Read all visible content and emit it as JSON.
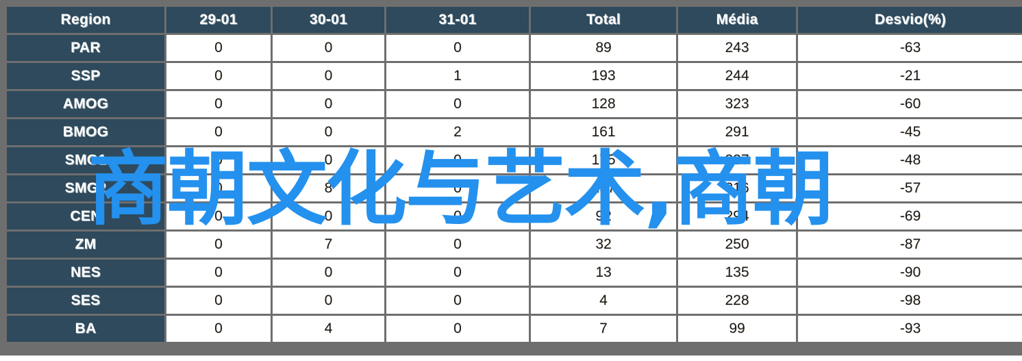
{
  "colors": {
    "header_bg": "#2e4a5c",
    "header_text": "#ffffff",
    "grid_border": "#6e6e6e",
    "cell_bg": "#ffffff",
    "cell_text": "#1a1a1a",
    "overlay_blue": "#2491ee"
  },
  "overlay": {
    "text": "商朝文化与艺术,商朝"
  },
  "table": {
    "columns": [
      "Region",
      "29-01",
      "30-01",
      "31-01",
      "Total",
      "Média",
      "Desvio(%)"
    ],
    "rows": [
      {
        "region": "PAR",
        "d29": "0",
        "d30": "0",
        "d31": "0",
        "total": "89",
        "media": "243",
        "desvio": "-63"
      },
      {
        "region": "SSP",
        "d29": "0",
        "d30": "0",
        "d31": "1",
        "total": "193",
        "media": "244",
        "desvio": "-21"
      },
      {
        "region": "AMOG",
        "d29": "0",
        "d30": "0",
        "d31": "0",
        "total": "128",
        "media": "323",
        "desvio": "-60"
      },
      {
        "region": "BMOG",
        "d29": "0",
        "d30": "0",
        "d31": "2",
        "total": "161",
        "media": "291",
        "desvio": "-45"
      },
      {
        "region": "SMG1",
        "d29": "0",
        "d30": "0",
        "d31": "0",
        "total": "175",
        "media": "337",
        "desvio": "-48"
      },
      {
        "region": "SMG2",
        "d29": "0",
        "d30": "8",
        "d31": "0",
        "total": "137",
        "media": "316",
        "desvio": "-57"
      },
      {
        "region": "CEN",
        "d29": "0",
        "d30": "0",
        "d31": "0",
        "total": "92",
        "media": "294",
        "desvio": "-69"
      },
      {
        "region": "ZM",
        "d29": "0",
        "d30": "7",
        "d31": "0",
        "total": "32",
        "media": "250",
        "desvio": "-87"
      },
      {
        "region": "NES",
        "d29": "0",
        "d30": "0",
        "d31": "0",
        "total": "13",
        "media": "135",
        "desvio": "-90"
      },
      {
        "region": "SES",
        "d29": "0",
        "d30": "0",
        "d31": "0",
        "total": "4",
        "media": "228",
        "desvio": "-98"
      },
      {
        "region": "BA",
        "d29": "0",
        "d30": "4",
        "d31": "0",
        "total": "7",
        "media": "99",
        "desvio": "-93"
      }
    ]
  },
  "chart_data": {
    "type": "table",
    "title": "",
    "columns": [
      "Region",
      "29-01",
      "30-01",
      "31-01",
      "Total",
      "Média",
      "Desvio(%)"
    ],
    "categories": [
      "PAR",
      "SSP",
      "AMOG",
      "BMOG",
      "SMG1",
      "SMG2",
      "CEN",
      "ZM",
      "NES",
      "SES",
      "BA"
    ],
    "series": [
      {
        "name": "29-01",
        "values": [
          0,
          0,
          0,
          0,
          0,
          0,
          0,
          0,
          0,
          0,
          0
        ]
      },
      {
        "name": "30-01",
        "values": [
          0,
          0,
          0,
          0,
          0,
          8,
          0,
          7,
          0,
          0,
          4
        ]
      },
      {
        "name": "31-01",
        "values": [
          0,
          1,
          0,
          2,
          0,
          0,
          0,
          0,
          0,
          0,
          0
        ]
      },
      {
        "name": "Total",
        "values": [
          89,
          193,
          128,
          161,
          175,
          137,
          92,
          32,
          13,
          4,
          7
        ]
      },
      {
        "name": "Média",
        "values": [
          243,
          244,
          323,
          291,
          337,
          316,
          294,
          250,
          135,
          228,
          99
        ]
      },
      {
        "name": "Desvio(%)",
        "values": [
          -63,
          -21,
          -60,
          -45,
          -48,
          -57,
          -69,
          -87,
          -90,
          -98,
          -93
        ]
      }
    ]
  }
}
